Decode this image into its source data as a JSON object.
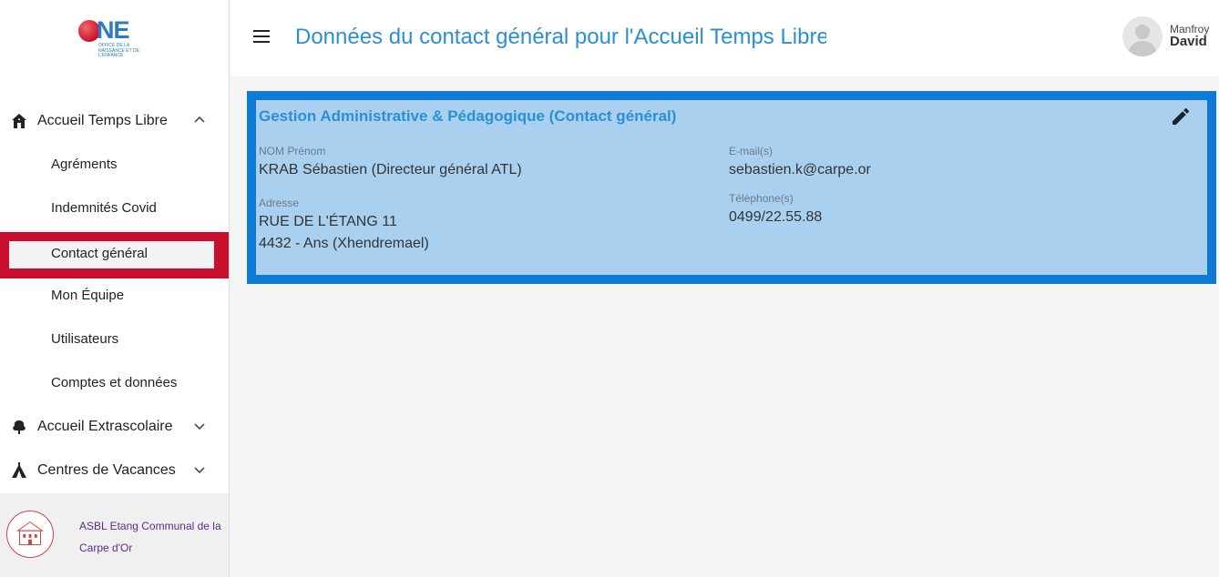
{
  "logo": {
    "word": "NE",
    "subtitle": "OFFICE DE LA NAISSANCE ET DE L'ENFANCE"
  },
  "sidebar": {
    "sections": [
      {
        "label": "Accueil Temps Libre",
        "icon": "house-icon",
        "expanded": true
      },
      {
        "label": "Accueil Extrascolaire",
        "icon": "tree-icon",
        "expanded": false
      },
      {
        "label": "Centres de Vacances",
        "icon": "tent-icon",
        "expanded": false
      }
    ],
    "subitems": [
      {
        "label": "Agréments"
      },
      {
        "label": "Indemnités Covid"
      },
      {
        "label": "Contact général",
        "active": true
      },
      {
        "label": "Mon Équipe"
      },
      {
        "label": "Utilisateurs"
      },
      {
        "label": "Comptes et données"
      }
    ],
    "organization": {
      "name": "ASBL Etang Communal de la Carpe d'Or"
    }
  },
  "header": {
    "title": "Données du contact général pour l'Accueil Temps Libre",
    "user": {
      "first_name": "Manfroy",
      "last_name": "David"
    }
  },
  "card": {
    "title": "Gestion Administrative & Pédagogique (Contact général)",
    "fields": {
      "name_label": "NOM Prénom",
      "name_value": "KRAB Sébastien (Directeur général ATL)",
      "address_label": "Adresse",
      "address_line1": "RUE DE L'ÉTANG 11",
      "address_line2": "4432 - Ans (Xhendremael)",
      "email_label": "E-mail(s)",
      "email_value": "sebastien.k@carpe.or",
      "phone_label": "Téléphone(s)",
      "phone_value": "0499/22.55.88"
    }
  },
  "colors": {
    "accent": "#2b8fd6",
    "active_highlight": "#c8102e",
    "card_frame": "#0d7bd6",
    "card_background": "#a9d1ef"
  }
}
